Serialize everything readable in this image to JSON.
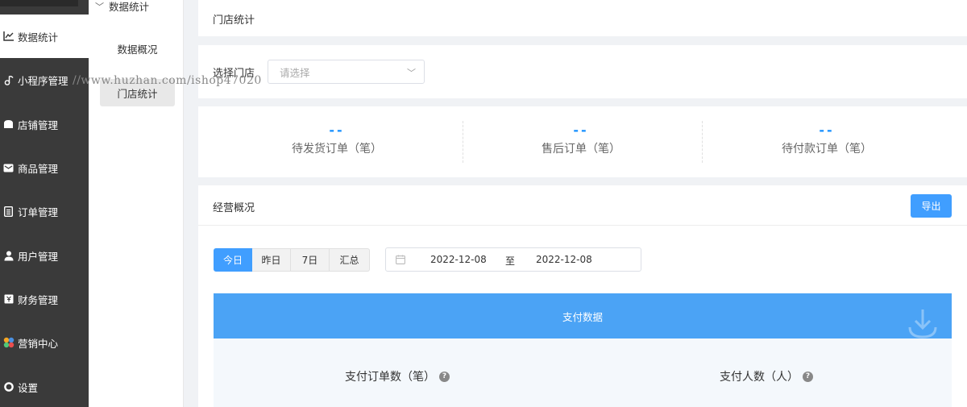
{
  "sidebar": {
    "items": [
      {
        "label": "数据统计",
        "icon": "line-chart-icon",
        "active": true
      },
      {
        "label": "小程序管理",
        "icon": "music-note-icon",
        "active": false
      },
      {
        "label": "店铺管理",
        "icon": "store-icon",
        "active": false
      },
      {
        "label": "商品管理",
        "icon": "envelope-icon",
        "active": false
      },
      {
        "label": "订单管理",
        "icon": "document-icon",
        "active": false
      },
      {
        "label": "用户管理",
        "icon": "user-icon",
        "active": false
      },
      {
        "label": "财务管理",
        "icon": "wallet-icon",
        "active": false
      },
      {
        "label": "营销中心",
        "icon": "pinwheel-icon",
        "active": false
      },
      {
        "label": "设置",
        "icon": "gear-icon",
        "active": false
      }
    ]
  },
  "submenu": {
    "group": "数据统计",
    "items": [
      {
        "label": "数据概况",
        "active": false
      },
      {
        "label": "门店统计",
        "active": true
      }
    ]
  },
  "watermark": "//www.huzhan.com/ishop47020",
  "header": {
    "title": "门店统计"
  },
  "filter": {
    "label": "选择门店",
    "placeholder": "请选择"
  },
  "stats": [
    {
      "value": "--",
      "label": "待发货订单（笔）"
    },
    {
      "value": "--",
      "label": "售后订单（笔）"
    },
    {
      "value": "--",
      "label": "待付款订单（笔）"
    }
  ],
  "business": {
    "title": "经营概况",
    "export_label": "导出",
    "ranges": [
      "今日",
      "昨日",
      "7日",
      "汇总"
    ],
    "active_range": "今日",
    "date_start": "2022-12-08",
    "date_sep": "至",
    "date_end": "2022-12-08",
    "pay_title": "支付数据",
    "metrics": [
      {
        "label": "支付订单数（笔）"
      },
      {
        "label": "支付人数（人）"
      }
    ]
  },
  "colors": {
    "accent": "#409eff",
    "sidebar": "#3a3a3a",
    "banner": "#4ba3f5"
  }
}
